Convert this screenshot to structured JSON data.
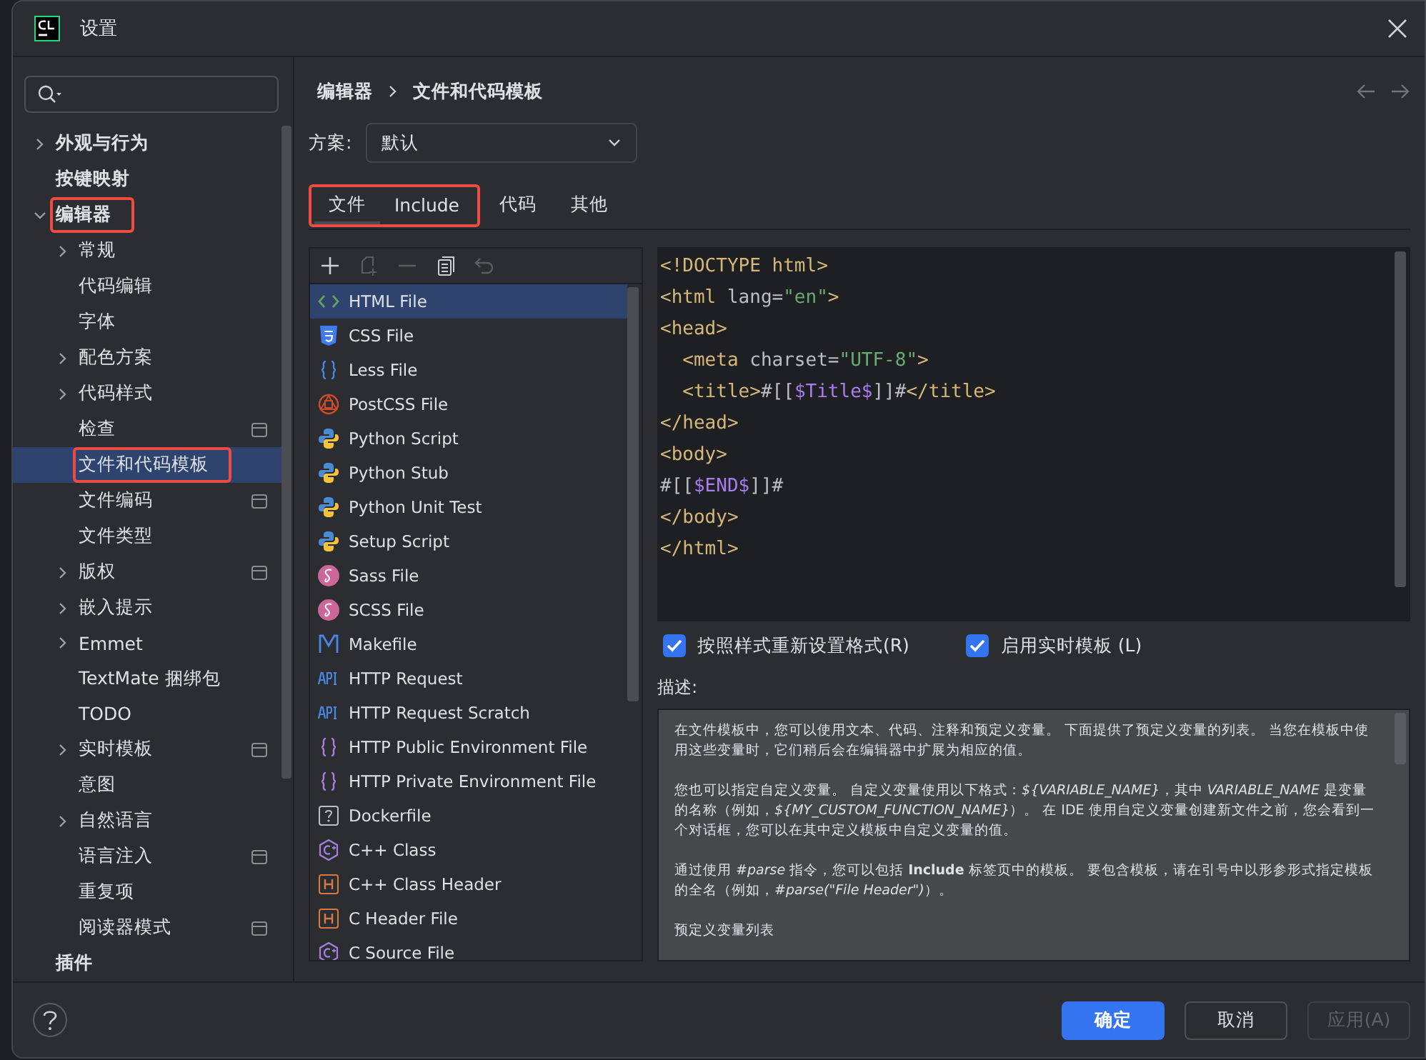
{
  "window": {
    "title": "设置"
  },
  "tree": [
    {
      "label": "外观与行为",
      "expanded": false,
      "selected": false
    },
    {
      "label": "按键映射",
      "selected": false
    },
    {
      "label": "编辑器",
      "expanded": true,
      "selected": false,
      "annotated": true,
      "children": [
        {
          "label": "常规",
          "expanded": false,
          "selected": false
        },
        {
          "label": "代码编辑",
          "selected": false
        },
        {
          "label": "字体",
          "selected": false
        },
        {
          "label": "配色方案",
          "expanded": false,
          "selected": false
        },
        {
          "label": "代码样式",
          "expanded": false,
          "selected": false
        },
        {
          "label": "检查",
          "selected": false,
          "project_scoped": true
        },
        {
          "label": "文件和代码模板",
          "selected": true,
          "annotated": true
        },
        {
          "label": "文件编码",
          "selected": false,
          "project_scoped": true
        },
        {
          "label": "文件类型",
          "selected": false
        },
        {
          "label": "版权",
          "expanded": false,
          "selected": false,
          "project_scoped": true
        },
        {
          "label": "嵌入提示",
          "expanded": false,
          "selected": false
        },
        {
          "label": "Emmet",
          "expanded": false,
          "selected": false
        },
        {
          "label": "TextMate 捆绑包",
          "selected": false
        },
        {
          "label": "TODO",
          "selected": false
        },
        {
          "label": "实时模板",
          "expanded": false,
          "selected": false,
          "project_scoped": true
        },
        {
          "label": "意图",
          "selected": false
        },
        {
          "label": "自然语言",
          "expanded": false,
          "selected": false
        },
        {
          "label": "语言注入",
          "selected": false,
          "project_scoped": true
        },
        {
          "label": "重复项",
          "selected": false
        },
        {
          "label": "阅读器模式",
          "selected": false,
          "project_scoped": true
        }
      ]
    },
    {
      "label": "插件",
      "selected": false
    }
  ],
  "breadcrumb": [
    "编辑器",
    "文件和代码模板"
  ],
  "scheme": {
    "label": "方案:",
    "value": "默认"
  },
  "tabs": [
    {
      "label": "文件",
      "selected": true,
      "annotated": true
    },
    {
      "label": "Include",
      "selected": false,
      "annotated": true
    },
    {
      "label": "代码",
      "selected": false
    },
    {
      "label": "其他",
      "selected": false
    }
  ],
  "toolbar": [
    {
      "kind": "add",
      "disabled": false
    },
    {
      "kind": "add-child",
      "disabled": true
    },
    {
      "kind": "remove",
      "disabled": true
    },
    {
      "kind": "copy",
      "disabled": false
    },
    {
      "kind": "reset",
      "disabled": true
    }
  ],
  "templates": [
    {
      "name": "HTML File",
      "kind": "html",
      "selected": true
    },
    {
      "name": "CSS File",
      "kind": "css",
      "selected": false
    },
    {
      "name": "Less File",
      "kind": "less",
      "selected": false
    },
    {
      "name": "PostCSS File",
      "kind": "postcss",
      "selected": false
    },
    {
      "name": "Python Script",
      "kind": "python",
      "selected": false
    },
    {
      "name": "Python Stub",
      "kind": "python",
      "selected": false
    },
    {
      "name": "Python Unit Test",
      "kind": "python",
      "selected": false
    },
    {
      "name": "Setup Script",
      "kind": "python",
      "selected": false
    },
    {
      "name": "Sass File",
      "kind": "sass",
      "selected": false
    },
    {
      "name": "SCSS File",
      "kind": "sass",
      "selected": false
    },
    {
      "name": "Makefile",
      "kind": "makefile",
      "selected": false
    },
    {
      "name": "HTTP Request",
      "kind": "http",
      "selected": false
    },
    {
      "name": "HTTP Request Scratch",
      "kind": "http",
      "selected": false
    },
    {
      "name": "HTTP Public Environment File",
      "kind": "env",
      "selected": false
    },
    {
      "name": "HTTP Private Environment File",
      "kind": "env",
      "selected": false
    },
    {
      "name": "Dockerfile",
      "kind": "docker",
      "selected": false
    },
    {
      "name": "C++ Class",
      "kind": "cpp",
      "selected": false
    },
    {
      "name": "C++ Class Header",
      "kind": "header",
      "selected": false
    },
    {
      "name": "C Header File",
      "kind": "header",
      "selected": false
    },
    {
      "name": "C Source File",
      "kind": "csource",
      "selected": false
    }
  ],
  "code": [
    [
      {
        "kind": "tag",
        "text": "<!DOCTYPE html>"
      }
    ],
    [
      {
        "kind": "tag",
        "text": "<html "
      },
      {
        "kind": "attr",
        "text": "lang="
      },
      {
        "kind": "string",
        "text": "\"en\""
      },
      {
        "kind": "tag",
        "text": ">"
      }
    ],
    [
      {
        "kind": "tag",
        "text": "<head>"
      }
    ],
    [
      {
        "kind": "tag",
        "text": "  <meta "
      },
      {
        "kind": "attr",
        "text": "charset="
      },
      {
        "kind": "string",
        "text": "\"UTF-8\""
      },
      {
        "kind": "tag",
        "text": ">"
      }
    ],
    [
      {
        "kind": "tag",
        "text": "  <title>"
      },
      {
        "kind": "plain",
        "text": "#[["
      },
      {
        "kind": "variable",
        "text": "$Title$"
      },
      {
        "kind": "plain",
        "text": "]]#"
      },
      {
        "kind": "tag",
        "text": "</title>"
      }
    ],
    [
      {
        "kind": "tag",
        "text": "</head>"
      }
    ],
    [
      {
        "kind": "tag",
        "text": "<body>"
      }
    ],
    [
      {
        "kind": "plain",
        "text": "#[["
      },
      {
        "kind": "variable",
        "text": "$END$"
      },
      {
        "kind": "plain",
        "text": "]]#"
      }
    ],
    [
      {
        "kind": "tag",
        "text": "</body>"
      }
    ],
    [
      {
        "kind": "tag",
        "text": "</html>"
      }
    ]
  ],
  "options": [
    {
      "label": "按照样式重新设置格式(R)",
      "checked": true
    },
    {
      "label": "启用实时模板 (L)",
      "checked": true
    }
  ],
  "description": {
    "label": "描述:",
    "paragraphs": [
      "在文件模板中，您可以使用文本、代码、注释和预定义变量。 下面提供了预定义变量的列表。 当您在模板中使用这些变量时，它们稍后会在编辑器中扩展为相应的值。",
      "您也可以指定自定义变量。 自定义变量使用以下格式：*${VARIABLE_NAME}*，其中 *VARIABLE_NAME* 是变量的名称（例如，*${MY_CUSTOM_FUNCTION_NAME}*）。 在 IDE 使用自定义变量创建新文件之前，您会看到一个对话框，您可以在其中定义模板中自定义变量的值。",
      "通过使用 *#parse* 指令，您可以包括 **Include** 标签页中的模板。 要包含模板，请在引号中以形参形式指定模板的全名（例如，*#parse(\"File Header\")*）。",
      "预定义变量列表"
    ]
  },
  "buttons": [
    {
      "label": "确定",
      "kind": "primary",
      "disabled": false
    },
    {
      "label": "取消",
      "kind": "normal",
      "disabled": false
    },
    {
      "label": "应用(A)",
      "kind": "normal",
      "disabled": true
    }
  ]
}
